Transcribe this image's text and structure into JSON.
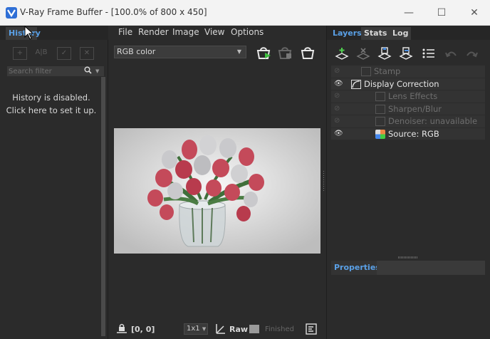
{
  "window": {
    "title": "V-Ray Frame Buffer - [100.0% of 800 x 450]",
    "min_glyph": "—",
    "max_glyph": "☐",
    "close_glyph": "✕"
  },
  "history": {
    "tab_label": "History",
    "search_placeholder": "Search filter",
    "message_line1": "History is disabled.",
    "message_line2": "Click here to set it up.",
    "toolbar": {
      "add_glyph": "+",
      "ab_glyph": "A|B",
      "check_glyph": "✓",
      "remove_glyph": "✕"
    }
  },
  "menu": {
    "file": "File",
    "render": "Render",
    "image": "Image",
    "view": "View",
    "options": "Options"
  },
  "channel": {
    "selected": "RGB color"
  },
  "statusbar": {
    "coords": "[0, 0]",
    "zoom": "1x1",
    "raw": "Raw",
    "status": "Finished"
  },
  "right": {
    "tabs": {
      "layers": "Layers",
      "stats": "Stats",
      "log": "Log"
    },
    "layers": [
      {
        "label": "Stamp",
        "visible": false,
        "indent": 1
      },
      {
        "label": "Display Correction",
        "visible": true,
        "indent": 1
      },
      {
        "label": "Lens Effects",
        "visible": false,
        "indent": 2
      },
      {
        "label": "Sharpen/Blur",
        "visible": false,
        "indent": 2
      },
      {
        "label": "Denoiser: unavailable",
        "visible": false,
        "indent": 2
      },
      {
        "label": "Source: RGB",
        "visible": true,
        "indent": 2
      }
    ],
    "properties_label": "Properties"
  },
  "icons": {
    "app": "vray-icon",
    "search": "search-icon",
    "eye": "eye-icon"
  },
  "colors": {
    "accent": "#5aa0e6",
    "panel_bg": "#2b2b2b"
  }
}
